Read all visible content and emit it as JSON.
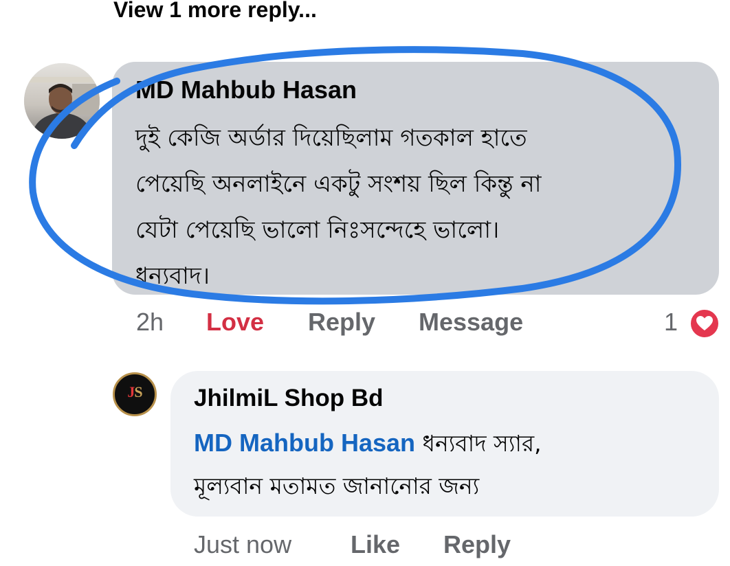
{
  "thread": {
    "view_more_label": "View 1 more reply..."
  },
  "main_comment": {
    "author": "MD Mahbub Hasan",
    "text_lines": [
      "দুই কেজি  অর্ডার দিয়েছিলাম গতকাল হাতে",
      "পেয়েছি অনলাইনে একটু সংশয় ছিল কিন্তু না",
      "যেটা পেয়েছি ভালো নিঃসন্দেহে ভালো।",
      "ধন্যবাদ।"
    ],
    "time": "2h",
    "love_label": "Love",
    "reply_label": "Reply",
    "message_label": "Message",
    "reaction_count": "1",
    "reaction_icon": "heart-icon",
    "love_color": "#d32f43",
    "annotation_color": "#2b7be4"
  },
  "reply_comment": {
    "author": "JhilmiL Shop Bd",
    "avatar_letters": {
      "j": "J",
      "s": "S"
    },
    "tagged_name": "MD Mahbub Hasan",
    "text_line1_rest": " ধন্যবাদ স্যার,",
    "text_line2": "মূল্যবান মতামত জানানোর জন্য",
    "time": "Just now",
    "like_label": "Like",
    "reply_label": "Reply",
    "link_color": "#1565c0"
  }
}
